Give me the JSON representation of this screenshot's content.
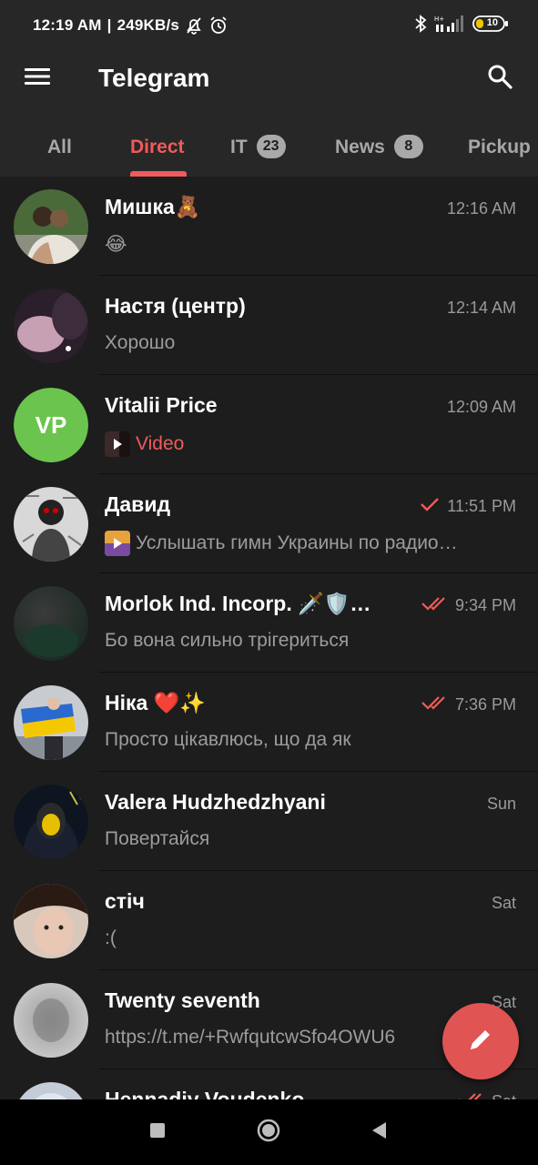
{
  "status": {
    "time": "12:19 AM",
    "speed": "249KB/s",
    "battery": "10",
    "icons": [
      "bell-off-icon",
      "alarm-icon",
      "bluetooth-icon",
      "signal-icon",
      "battery-icon"
    ]
  },
  "app": {
    "title": "Telegram",
    "accent": "#f05a5a"
  },
  "tabs": [
    {
      "label": "All",
      "badge": ""
    },
    {
      "label": "Direct",
      "badge": ""
    },
    {
      "label": "IT",
      "badge": "23"
    },
    {
      "label": "News",
      "badge": "8"
    },
    {
      "label": "Pickup",
      "badge": ""
    }
  ],
  "chats": [
    {
      "name": "Мишка🧸",
      "time": "12:16 AM",
      "message": "😂",
      "check": "none"
    },
    {
      "name": "Настя (центр)",
      "time": "12:14 AM",
      "message": "Хорошо",
      "check": "none"
    },
    {
      "name": "Vitalii Price",
      "initials": "VP",
      "time": "12:09 AM",
      "message": "Video",
      "check": "none"
    },
    {
      "name": "Давид",
      "time": "11:51 PM",
      "message": "Услышать гимн Украины по радио…",
      "check": "single"
    },
    {
      "name": "Morlok Ind. Incorp. 🗡️🛡️…",
      "time": "9:34 PM",
      "message": "Бо вона сильно трігериться",
      "check": "double"
    },
    {
      "name": "Ніка ❤️✨",
      "time": "7:36 PM",
      "message": "Просто цікавлюсь, що да як",
      "check": "double"
    },
    {
      "name": "Valera Hudzhedzhyani",
      "time": "Sun",
      "message": "Повертайся",
      "check": "none"
    },
    {
      "name": "стіч",
      "time": "Sat",
      "message": ":(",
      "check": "none"
    },
    {
      "name": "Twenty seventh",
      "time": "Sat",
      "message": "https://t.me/+RwfqutcwSfo4OWU6",
      "check": "none"
    },
    {
      "name": "Hennadiy Voudenko",
      "time": "Sat",
      "message": "",
      "check": "double"
    }
  ]
}
